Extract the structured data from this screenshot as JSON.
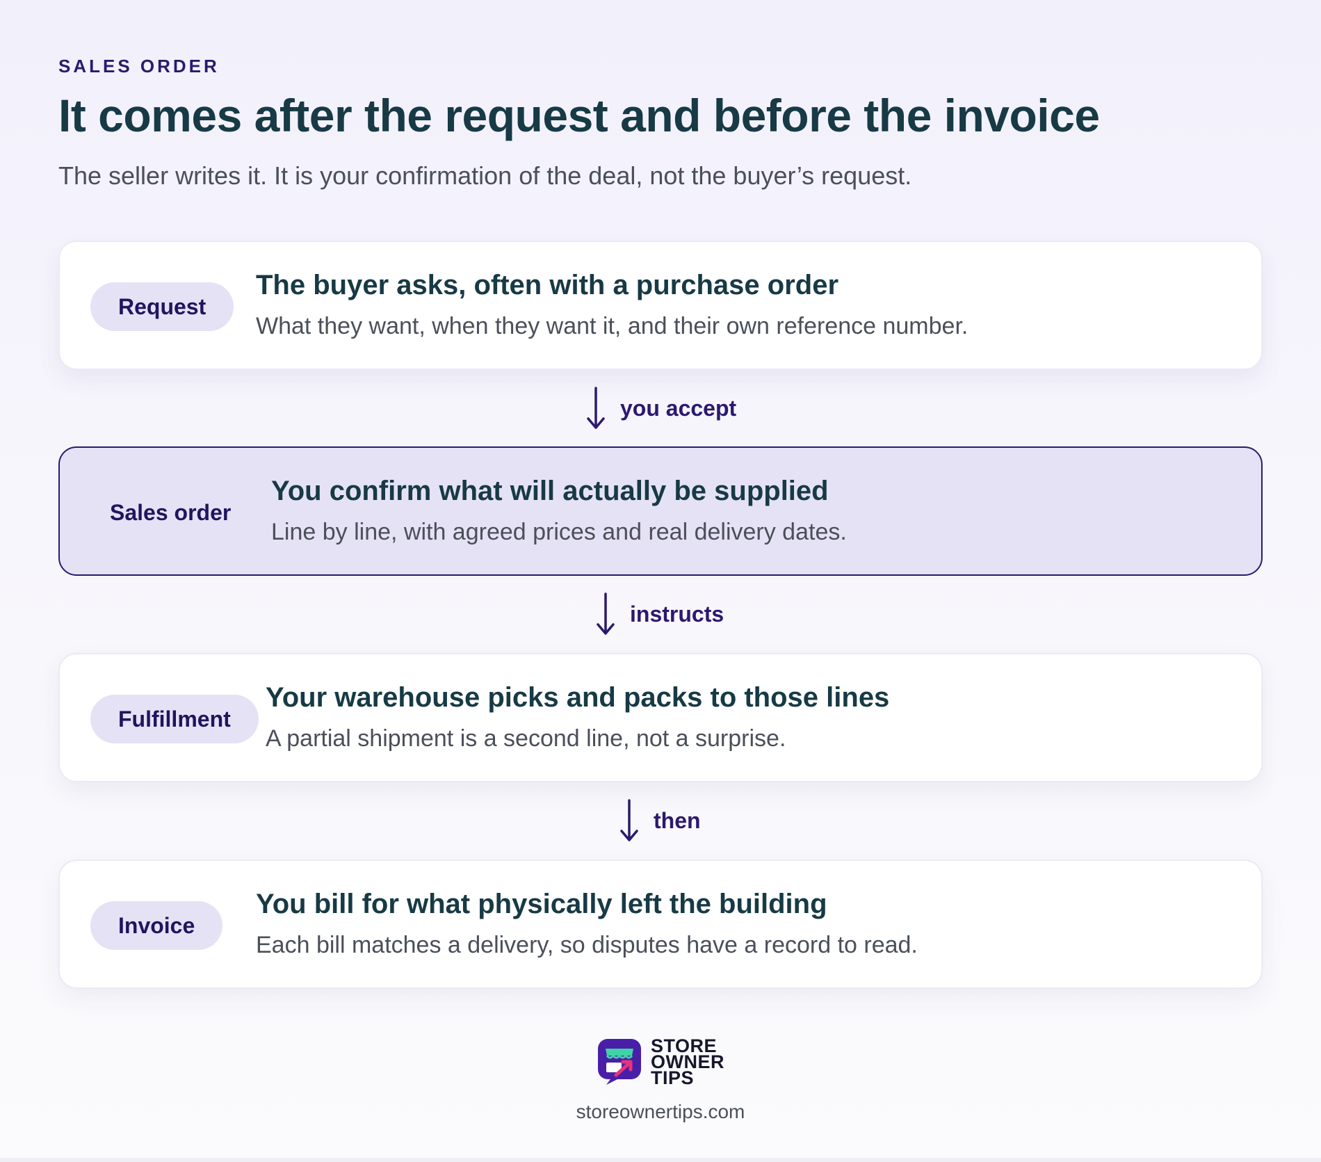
{
  "header": {
    "eyebrow": "SALES ORDER",
    "title": "It comes after the request and before the invoice",
    "subtitle": "The seller writes it. It is your confirmation of the deal, not the buyer’s request."
  },
  "steps": [
    {
      "tag": "Request",
      "title": "The buyer asks, often with a purchase order",
      "description": "What they want, when they want it, and their own reference number.",
      "highlighted": false
    },
    {
      "tag": "Sales order",
      "title": "You confirm what will actually be supplied",
      "description": "Line by line, with agreed prices and real delivery dates.",
      "highlighted": true
    },
    {
      "tag": "Fulfillment",
      "title": "Your warehouse picks and packs to those lines",
      "description": "A partial shipment is a second line, not a surprise.",
      "highlighted": false
    },
    {
      "tag": "Invoice",
      "title": "You bill for what physically left the building",
      "description": "Each bill matches a delivery, so disputes have a record to read.",
      "highlighted": false
    }
  ],
  "connectors": [
    {
      "label": "you accept",
      "icon": "arrow-down-icon"
    },
    {
      "label": "instructs",
      "icon": "arrow-down-icon"
    },
    {
      "label": "then",
      "icon": "arrow-down-icon"
    }
  ],
  "footer": {
    "logo_lines": [
      "STORE",
      "OWNER",
      "TIPS"
    ],
    "url": "storeownertips.com"
  },
  "colors": {
    "accent": "#2a1a6e",
    "heading": "#173a45",
    "pill_bg": "#e6e2f5",
    "logo_purple": "#4a1fa8",
    "logo_green": "#3fd4a8",
    "logo_pink": "#e8337a"
  }
}
